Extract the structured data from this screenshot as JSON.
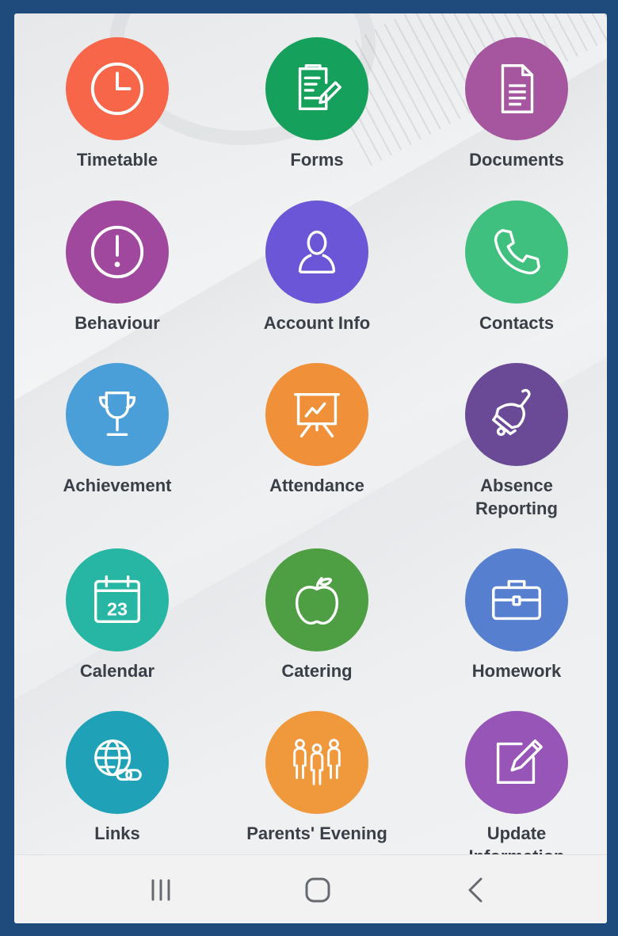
{
  "tiles": [
    {
      "label": "Timetable",
      "icon": "clock-icon",
      "color": "#f8664a"
    },
    {
      "label": "Forms",
      "icon": "form-edit-icon",
      "color": "#15a05b"
    },
    {
      "label": "Documents",
      "icon": "document-icon",
      "color": "#a5569f"
    },
    {
      "label": "Behaviour",
      "icon": "exclamation-icon",
      "color": "#a0489e"
    },
    {
      "label": "Account Info",
      "icon": "user-icon",
      "color": "#6a56d6"
    },
    {
      "label": "Contacts",
      "icon": "phone-icon",
      "color": "#40c07e"
    },
    {
      "label": "Achievement",
      "icon": "trophy-icon",
      "color": "#4b9fd8"
    },
    {
      "label": "Attendance",
      "icon": "presentation-board-icon",
      "color": "#f0913a"
    },
    {
      "label": "Absence\nReporting",
      "icon": "bell-icon",
      "color": "#6a4a96"
    },
    {
      "label": "Calendar",
      "icon": "calendar-icon",
      "color": "#26b6a3",
      "day": "23"
    },
    {
      "label": "Catering",
      "icon": "apple-icon",
      "color": "#4e9f43"
    },
    {
      "label": "Homework",
      "icon": "briefcase-icon",
      "color": "#567fd0"
    },
    {
      "label": "Links",
      "icon": "globe-link-icon",
      "color": "#1fa2b7"
    },
    {
      "label": "Parents' Evening",
      "icon": "people-group-icon",
      "color": "#f0993c"
    },
    {
      "label": "Update\nInformation",
      "icon": "edit-note-icon",
      "color": "#9855b8"
    }
  ],
  "navbar": {
    "recents": "recents-icon",
    "home": "home-icon",
    "back": "back-icon"
  }
}
